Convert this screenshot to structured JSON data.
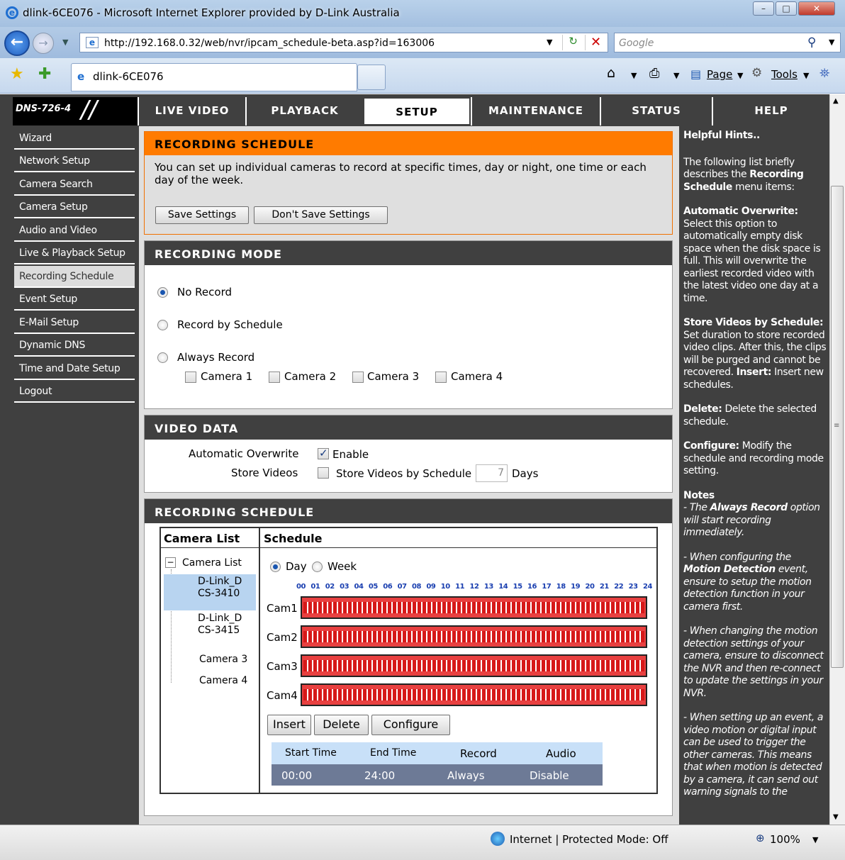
{
  "window": {
    "title": "dlink-6CE076 - Microsoft Internet Explorer provided by D-Link Australia"
  },
  "browser": {
    "url": "http://192.168.0.32/web/nvr/ipcam_schedule-beta.asp?id=163006",
    "search_placeholder": "Google",
    "tab_title": "dlink-6CE076",
    "page_menu": "Page",
    "tools_menu": "Tools"
  },
  "device": {
    "model": "DNS-726-4"
  },
  "topnav": [
    "LIVE VIDEO",
    "PLAYBACK",
    "SETUP",
    "MAINTENANCE",
    "STATUS",
    "HELP"
  ],
  "sidebar": [
    "Wizard",
    "Network Setup",
    "Camera Search",
    "Camera Setup",
    "Audio and Video",
    "Live & Playback Setup",
    "Recording Schedule",
    "Event Setup",
    "E-Mail Setup",
    "Dynamic DNS",
    "Time and Date Setup",
    "Logout"
  ],
  "intro": {
    "title": "RECORDING SCHEDULE",
    "text": "You can set up individual cameras to record at specific times, day or night, one time or each day of the week.",
    "save": "Save Settings",
    "dont_save": "Don't Save Settings"
  },
  "mode": {
    "title": "RECORDING MODE",
    "no_record": "No Record",
    "by_schedule": "Record by Schedule",
    "always": "Always Record",
    "cameras": [
      "Camera 1",
      "Camera 2",
      "Camera 3",
      "Camera 4"
    ]
  },
  "video_data": {
    "title": "VIDEO DATA",
    "overwrite_label": "Automatic Overwrite",
    "enable": "Enable",
    "store_label": "Store Videos",
    "store_by_schedule": "Store Videos by Schedule",
    "days_value": "7",
    "days_unit": "Days"
  },
  "schedule": {
    "title": "RECORDING SCHEDULE",
    "camera_list_header": "Camera List",
    "schedule_header": "Schedule",
    "tree_root": "Camera List",
    "tree": [
      "D-Link_DCS-3410",
      "D-Link_DCS-3415",
      "Camera 3",
      "Camera 4"
    ],
    "day": "Day",
    "week": "Week",
    "hours": [
      "00",
      "01",
      "02",
      "03",
      "04",
      "05",
      "06",
      "07",
      "08",
      "09",
      "10",
      "11",
      "12",
      "13",
      "14",
      "15",
      "16",
      "17",
      "18",
      "19",
      "20",
      "21",
      "22",
      "23",
      "24"
    ],
    "cams": [
      "Cam1",
      "Cam2",
      "Cam3",
      "Cam4"
    ],
    "insert": "Insert",
    "delete": "Delete",
    "configure": "Configure",
    "table_headers": [
      "Start Time",
      "End Time",
      "Record",
      "Audio"
    ],
    "table_row": [
      "00:00",
      "24:00",
      "Always",
      "Disable"
    ]
  },
  "hints": {
    "title": "Helpful Hints..",
    "intro1": "The following list briefly describes the ",
    "intro_bold": "Recording Schedule",
    "intro2": " menu items:",
    "h1": "Automatic Overwrite:",
    "t1": "Select this option to automatically empty disk space when the disk space is full. This will overwrite the earliest recorded video with the latest video one day at a time.",
    "h2": "Store Videos by Schedule:",
    "t2": " Set duration to store recorded video clips. After this, the clips will be purged and cannot be recovered. ",
    "h2b": "Insert:",
    "t2b": " Insert new schedules.",
    "h3": "Delete:",
    "t3": " Delete the selected schedule.",
    "h4": "Configure:",
    "t4": " Modify the schedule and recording mode setting.",
    "notes": "Notes",
    "n1a": "- The ",
    "n1b": "Always Record",
    "n1c": " option will start recording immediately.",
    "n2a": "- When configuring the ",
    "n2b": "Motion Detection",
    "n2c": " event, ensure to setup the motion detection function in your camera first.",
    "n3": "- When changing the motion detection settings of your camera, ensure to disconnect the NVR and then re-connect to update the settings in your NVR.",
    "n4": "- When setting up an event, a video motion or digital input can be used to trigger the other cameras. This means that when motion is detected by a camera, it can send out warning signals to the"
  },
  "statusbar": {
    "zone": "Internet | Protected Mode: Off",
    "zoom": "100%"
  }
}
